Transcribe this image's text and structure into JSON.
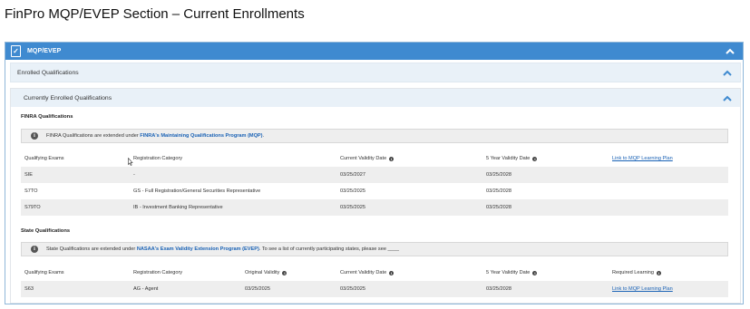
{
  "page_title": "FinPro MQP/EVEP Section – Current Enrollments",
  "panel": {
    "title": "MQP/EVEP"
  },
  "enrolled_section": {
    "title": "Enrolled Qualifications"
  },
  "current_section": {
    "title": "Currently Enrolled Qualifications"
  },
  "finra": {
    "label": "FINRA Qualifications",
    "info_text": "FINRA Qualifications are extended under ",
    "info_link": "FINRA's Maintaining Qualifications Program (MQP)",
    "info_suffix": ".",
    "headers": [
      "Qualifying Exams",
      "Registration Category",
      "Current Validity Date",
      "5 Year Validity Date",
      "Link to MQP Learning Plan"
    ],
    "rows": [
      {
        "exam": "SIE",
        "category": "-",
        "current": "03/25/2027",
        "five_year": "03/25/2028"
      },
      {
        "exam": "S7TO",
        "category": "GS - Full Registration/General Securities Representative",
        "current": "03/25/2025",
        "five_year": "03/25/2028"
      },
      {
        "exam": "S79TO",
        "category": "IB - Investment Banking Representative",
        "current": "03/25/2025",
        "five_year": "03/25/2028"
      }
    ]
  },
  "state": {
    "label": "State Qualifications",
    "info_text": "State Qualifications are extended under ",
    "info_link": "NASAA's Exam Validity Extension Program (EVEP)",
    "info_suffix": ". To see a list of currently participating states, please see ____",
    "headers": [
      "Qualifying Exams",
      "Registration Category",
      "Original Validity",
      "Current Validity Date",
      "5 Year Validity Date",
      "Required Learning"
    ],
    "rows": [
      {
        "exam": "S63",
        "category": "AG - Agent",
        "original": "03/25/2025",
        "current": "03/25/2025",
        "five_year": "03/25/2028",
        "link": "Link to MQP Learning Plan"
      }
    ]
  },
  "colors": {
    "header_blue": "#3f8ad0",
    "subheader_bg": "#e9f1f8",
    "link": "#1a62b5",
    "row_shade": "#eeeeee"
  },
  "icons": [
    "document-icon",
    "chevron-up-icon",
    "info-icon"
  ]
}
